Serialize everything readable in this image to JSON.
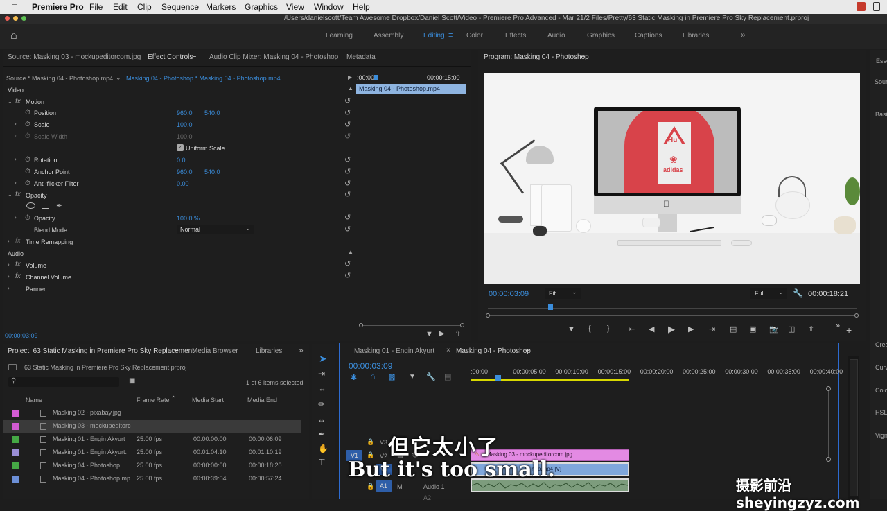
{
  "menubar": {
    "app": "Premiere Pro",
    "items": [
      "File",
      "Edit",
      "Clip",
      "Sequence",
      "Markers",
      "Graphics",
      "View",
      "Window",
      "Help"
    ]
  },
  "titlebar": {
    "path": "/Users/danielscott/Team Awesome Dropbox/Daniel Scott/Video - Premiere Pro Advanced - Mar 21/2 Files/Pretty/63 Static Masking in Premiere Pro Sky Replacement.prproj"
  },
  "workspaces": [
    "Learning",
    "Assembly",
    "Editing",
    "Color",
    "Effects",
    "Audio",
    "Graphics",
    "Captions",
    "Libraries"
  ],
  "source_panel": {
    "tabs": [
      "Source: Masking 03 - mockupeditorcom.jpg",
      "Effect Controls",
      "Audio Clip Mixer: Masking 04 - Photoshop",
      "Metadata"
    ],
    "source_clip": "Source * Masking 04 - Photoshop.mp4",
    "sequence_clip": "Masking 04 - Photoshop * Masking 04 - Photoshop.mp4",
    "timeline_start": ":00:00",
    "timeline_end": "00:00:15:00",
    "clip_bar": "Masking 04 - Photoshop.mp4",
    "section_video": "Video",
    "section_audio": "Audio",
    "timecode": "00:00:03:09",
    "rows": [
      {
        "label": "Motion",
        "fx": true
      },
      {
        "label": "Position",
        "v1": "960.0",
        "v2": "540.0"
      },
      {
        "label": "Scale",
        "v1": "100.0"
      },
      {
        "label": "Scale Width",
        "v1": "100.0"
      },
      {
        "label": "Uniform Scale"
      },
      {
        "label": "Rotation",
        "v1": "0.0"
      },
      {
        "label": "Anchor Point",
        "v1": "960.0",
        "v2": "540.0"
      },
      {
        "label": "Anti-flicker Filter",
        "v1": "0.00"
      },
      {
        "label": "Opacity",
        "fx": true
      },
      {
        "label": "Opacity",
        "v1": "100.0 %"
      },
      {
        "label": "Blend Mode",
        "v1": "Normal"
      },
      {
        "label": "Time Remapping"
      },
      {
        "label": "Volume"
      },
      {
        "label": "Channel Volume"
      },
      {
        "label": "Panner"
      }
    ]
  },
  "program_monitor": {
    "title": "Program: Masking 04 - Photoshop",
    "timecode": "00:00:03:09",
    "fit": "Fit",
    "quality": "Full",
    "duration": "00:00:18:21",
    "screen_logo": "Hu",
    "brand": "adidas"
  },
  "project_panel": {
    "tabs": [
      "Project: 63 Static Masking in Premiere Pro Sky Replacement",
      "Media Browser",
      "Libraries"
    ],
    "file": "63 Static Masking in Premiere Pro Sky Replacement.prproj",
    "items_selected": "1 of 6 items selected",
    "columns": [
      "Name",
      "Frame Rate",
      "Media Start",
      "Media End"
    ],
    "rows": [
      {
        "color": "#d35bd3",
        "name": "Masking 02 - pixabay.jpg",
        "fps": "",
        "start": "",
        "end": ""
      },
      {
        "color": "#d35bd3",
        "name": "Masking 03 - mockupeditorc",
        "fps": "",
        "start": "",
        "end": ""
      },
      {
        "color": "#45a845",
        "name": "Masking 01 - Engin Akyurt",
        "fps": "25.00 fps",
        "start": "00:00:00:00",
        "end": "00:00:06:09"
      },
      {
        "color": "#9a8ed6",
        "name": "Masking 01 - Engin Akyurt.",
        "fps": "25.00 fps",
        "start": "00:01:04:10",
        "end": "00:01:10:19"
      },
      {
        "color": "#45a845",
        "name": "Masking 04 - Photoshop",
        "fps": "25.00 fps",
        "start": "00:00:00:00",
        "end": "00:00:18:20"
      },
      {
        "color": "#6c8fd6",
        "name": "Masking 04 - Photoshop.mp",
        "fps": "25.00 fps",
        "start": "00:00:39:04",
        "end": "00:00:57:24"
      }
    ]
  },
  "timeline": {
    "tabs": [
      "Masking 01 - Engin Akyurt",
      "Masking 04 - Photoshop"
    ],
    "timecode": "00:00:03:09",
    "ruler": [
      ":00:00",
      "00:00:05:00",
      "00:00:10:00",
      "00:00:15:00",
      "00:00:20:00",
      "00:00:25:00",
      "00:00:30:00",
      "00:00:35:00",
      "00:00:40:00"
    ],
    "tracks": [
      "V3",
      "V2",
      "V1",
      "A1",
      "A2"
    ],
    "track_src": [
      "V1",
      "A1"
    ],
    "track_mute": "M",
    "audio_track_label": "Audio 1",
    "clip_v2": "Masking 03 - mockupeditorcom.jpg",
    "clip_v1": "Masking 04 - Photoshop.mp4 [V]",
    "clip_v1_visible": "hop.mp4 [V]"
  },
  "right_panel": {
    "labels": [
      "Esse",
      "Sour",
      "Basi",
      "Crea",
      "Curv",
      "Colo",
      "HSL",
      "Vign"
    ]
  },
  "subtitles": {
    "cn": "但它太小了",
    "en": "But it's too small."
  },
  "watermark": "摄影前沿 sheyingzyz.com"
}
